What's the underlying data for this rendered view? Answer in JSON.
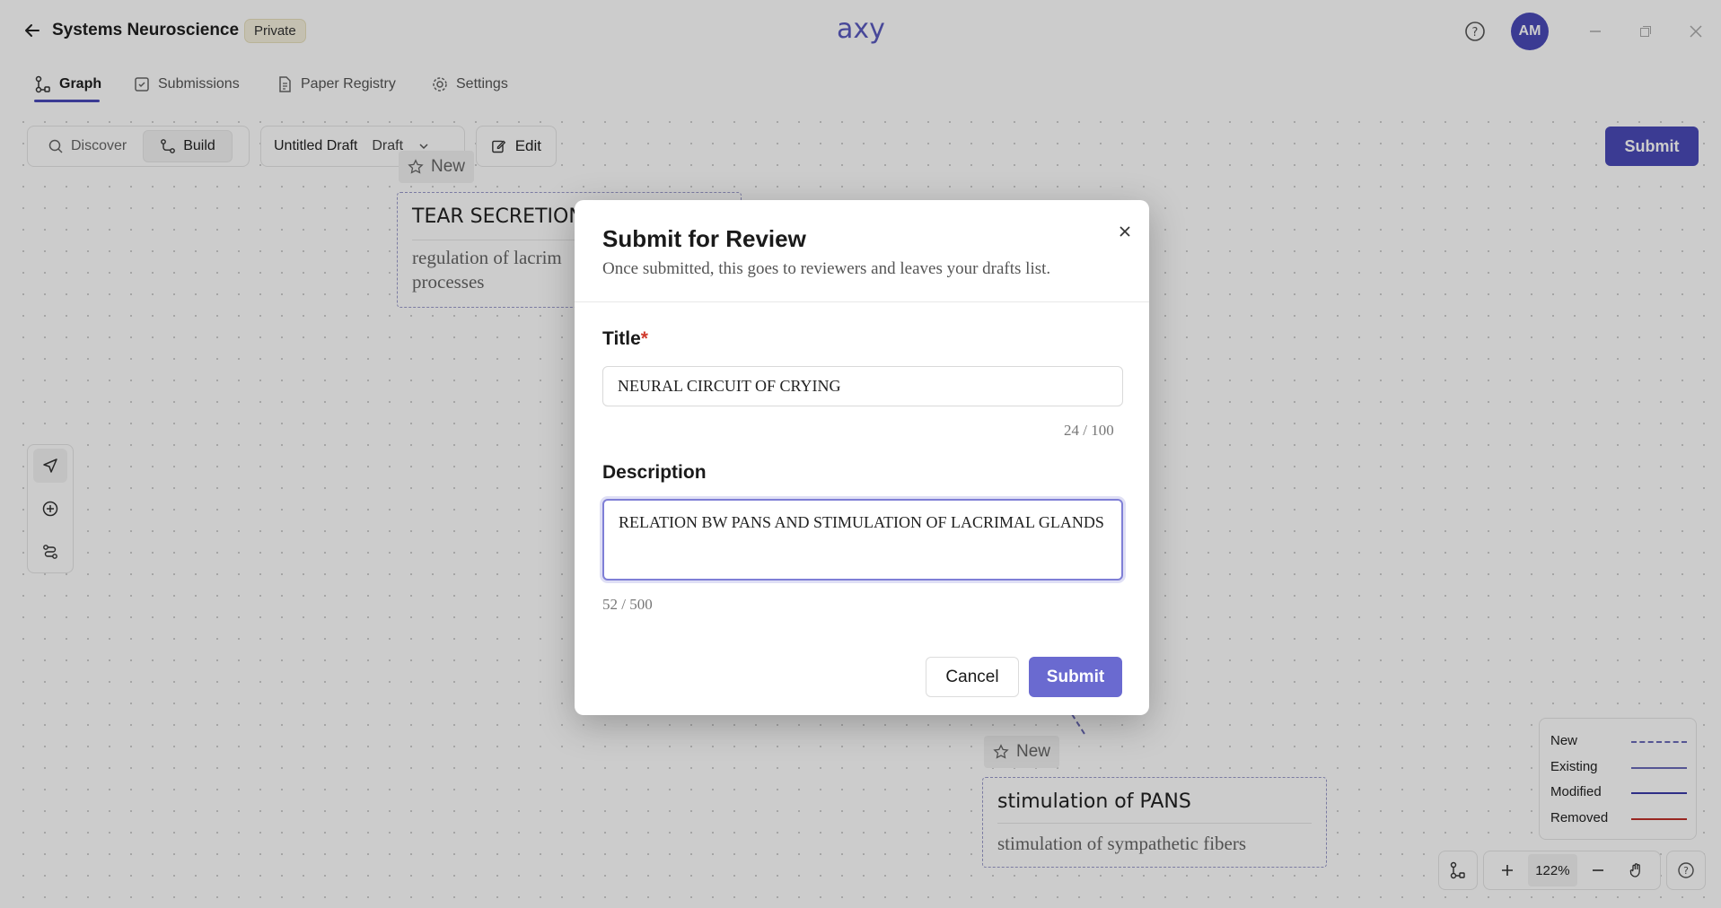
{
  "header": {
    "project_title": "Systems Neuroscience",
    "visibility_badge": "Private",
    "logo_text": "axy",
    "avatar_initials": "AM"
  },
  "tabs": [
    {
      "label": "Graph",
      "icon": "graph-icon",
      "active": true
    },
    {
      "label": "Submissions",
      "icon": "submissions-icon",
      "active": false
    },
    {
      "label": "Paper Registry",
      "icon": "document-icon",
      "active": false
    },
    {
      "label": "Settings",
      "icon": "gear-icon",
      "active": false
    }
  ],
  "toolbar": {
    "modes": [
      {
        "label": "Discover",
        "icon": "discover-icon",
        "active": false
      },
      {
        "label": "Build",
        "icon": "build-icon",
        "active": true
      }
    ],
    "draft_name": "Untitled Draft",
    "draft_status": "Draft",
    "edit_label": "Edit",
    "submit_label": "Submit"
  },
  "nodes": [
    {
      "tag": "New",
      "title": "TEAR SECRETION",
      "desc_line1": "regulation of lacrim",
      "desc_line2": "processes"
    },
    {
      "tag": "New",
      "title": "stimulation of PANS",
      "desc_line1": "stimulation of sympathetic fibers"
    }
  ],
  "legend": [
    {
      "label": "New",
      "color": "#6b6bb8",
      "style": "dashed"
    },
    {
      "label": "Existing",
      "color": "#6b6bb8",
      "style": "solid"
    },
    {
      "label": "Modified",
      "color": "#3a3aa8",
      "style": "solid"
    },
    {
      "label": "Removed",
      "color": "#c0302a",
      "style": "solid"
    }
  ],
  "zoom": {
    "value": "122%"
  },
  "modal": {
    "title": "Submit for Review",
    "subtitle": "Once submitted, this goes to reviewers and leaves your drafts list.",
    "title_label": "Title",
    "title_required_mark": "*",
    "title_value": "NEURAL CIRCUIT OF CRYING",
    "title_counter": "24 / 100",
    "description_label": "Description",
    "description_value": "RELATION BW PANS AND STIMULATION OF LACRIMAL GLANDS",
    "description_counter": "52 / 500",
    "cancel_label": "Cancel",
    "submit_label": "Submit"
  },
  "colors": {
    "accent": "#4a4ab8",
    "modal_submit": "#6a6ad0",
    "required": "#d03b2e"
  }
}
